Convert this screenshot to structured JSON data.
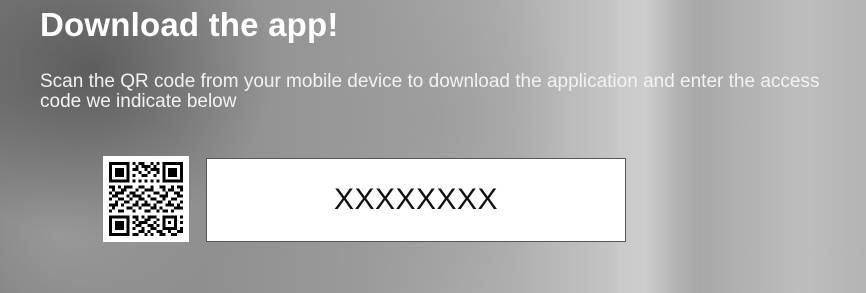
{
  "promo": {
    "title": "Download the app!",
    "subtitle": "Scan the QR code from your mobile device to download the application and enter the access code we indicate below",
    "qr_icon": "qr-code-icon",
    "access_code": "XXXXXXXX"
  },
  "colors": {
    "text": "#ffffff",
    "code_box_bg": "#ffffff",
    "code_text": "#111111"
  }
}
